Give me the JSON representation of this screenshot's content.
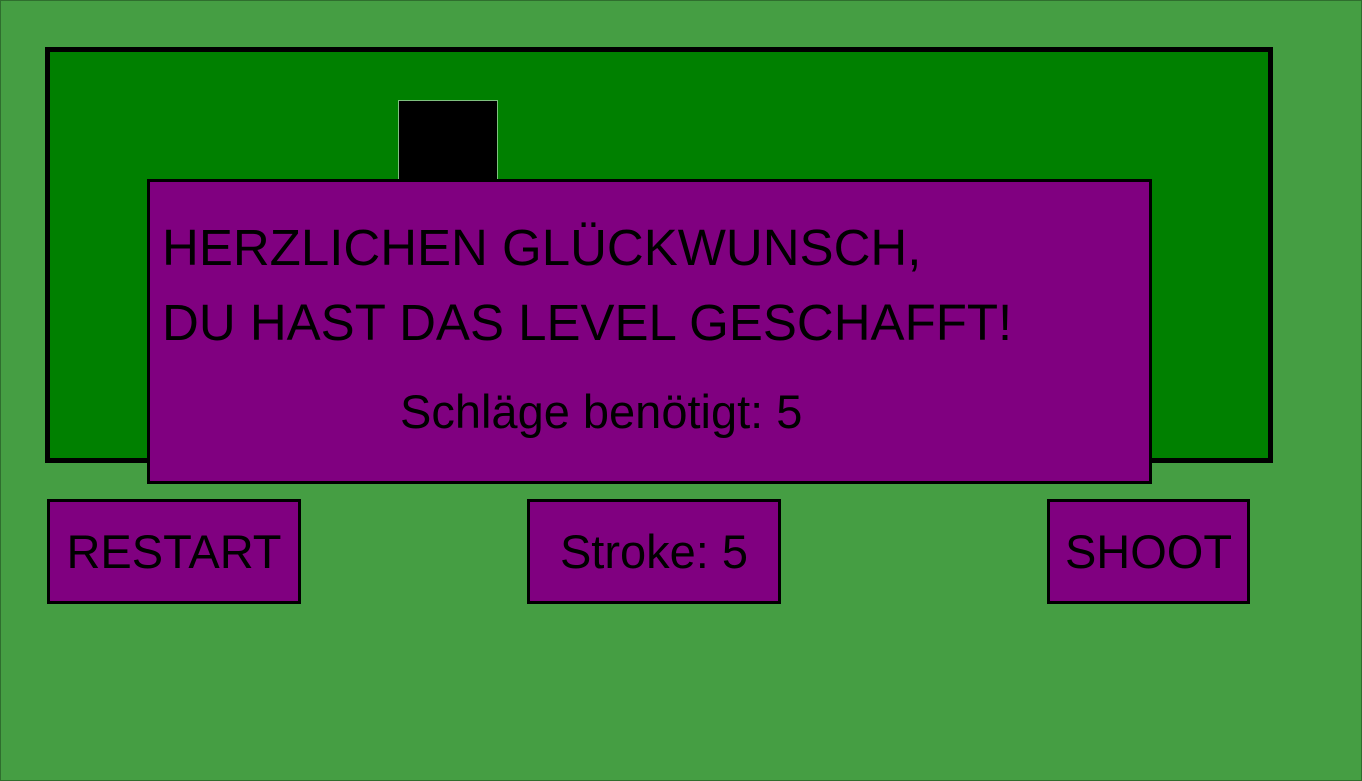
{
  "colors": {
    "background": "#459e43",
    "course": "#008000",
    "hole": "#000000",
    "panel": "#800080",
    "text": "#000000"
  },
  "dialog": {
    "line1": "HERZLICHEN GLÜCKWUNSCH,",
    "line2": "DU HAST DAS LEVEL GESCHAFFT!",
    "strokes_text": "Schläge benötigt: 5"
  },
  "controls": {
    "restart_label": "RESTART",
    "stroke_label": "Stroke: 5",
    "shoot_label": "SHOOT"
  }
}
